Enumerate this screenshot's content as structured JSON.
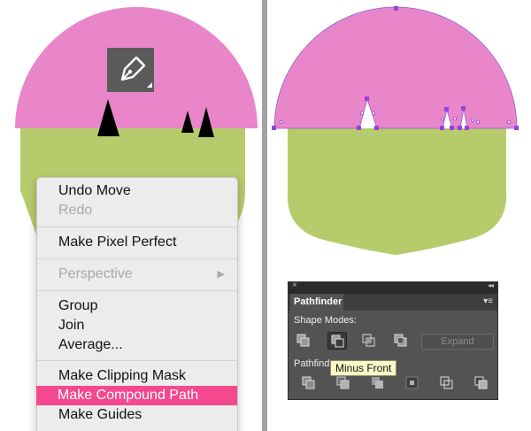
{
  "context_menu": {
    "items": [
      {
        "label": "Undo Move",
        "enabled": true
      },
      {
        "label": "Redo",
        "enabled": false
      },
      {
        "label": "Make Pixel Perfect",
        "enabled": true
      },
      {
        "label": "Perspective",
        "enabled": false,
        "submenu": true
      },
      {
        "label": "Group",
        "enabled": true
      },
      {
        "label": "Join",
        "enabled": true
      },
      {
        "label": "Average...",
        "enabled": true
      },
      {
        "label": "Make Clipping Mask",
        "enabled": true
      },
      {
        "label": "Make Compound Path",
        "enabled": true,
        "highlighted": true
      },
      {
        "label": "Make Guides",
        "enabled": true
      }
    ],
    "submenu_arrow": "▶"
  },
  "pathfinder": {
    "title": "Pathfinder",
    "close_glyph": "×",
    "collapse_glyph": "◂◂",
    "menu_glyph": "▾≡",
    "shape_modes_label": "Shape Modes:",
    "pathfinders_label": "Pathfind",
    "expand_label": "Expand",
    "tooltip": "Minus Front",
    "active_button": "minus-front"
  },
  "colors": {
    "cap_pink": "#e986c9",
    "stem_green": "#b6cc6c",
    "spike_black": "#000000",
    "anchor_purple": "#9b40e0",
    "menu_highlight": "#f4488f",
    "panel_bg": "#535353"
  },
  "icons": {
    "tool": "pen-tool-icon",
    "shape_modes": [
      "unite-icon",
      "minus-front-icon",
      "intersect-icon",
      "exclude-icon"
    ],
    "pathfinders": [
      "divide-icon",
      "trim-icon",
      "merge-icon",
      "crop-icon",
      "outline-icon",
      "minus-back-icon"
    ]
  }
}
